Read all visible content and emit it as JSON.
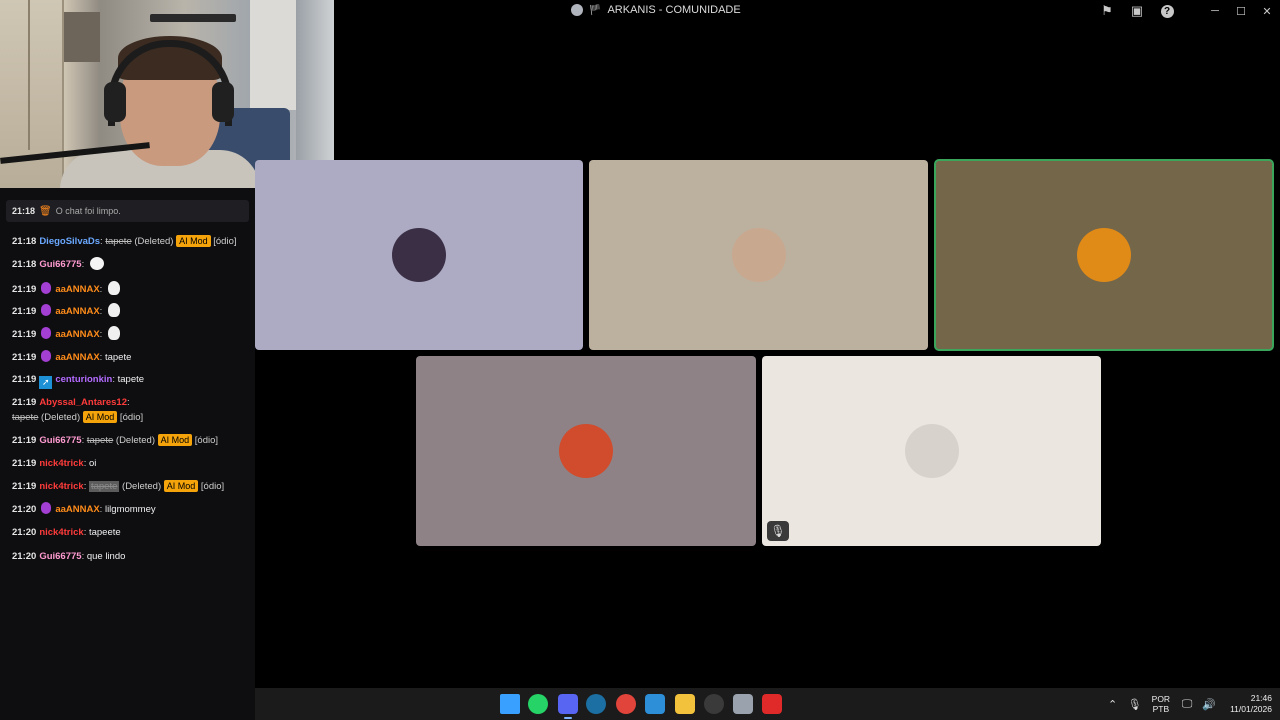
{
  "window": {
    "title": "ARKANIS - COMUNIDADE",
    "icons": [
      "inbox-icon",
      "window-icon",
      "help-icon"
    ],
    "help_glyph": "?",
    "controls": [
      "minimize",
      "maximize",
      "close"
    ]
  },
  "chat": {
    "system": {
      "time": "21:18",
      "text": "O chat foi limpo."
    },
    "messages": [
      {
        "time": "21:18",
        "user": "DiegoSilvaDs",
        "user_color": "#6aa8ff",
        "deleted_text": "tapete",
        "deleted_label": "(Deleted)",
        "badge": "AI Mod",
        "reason": "[ódio]"
      },
      {
        "time": "21:18",
        "user": "Gui66775",
        "user_color": "#ff9bd0",
        "emote": "blob"
      },
      {
        "time": "21:19",
        "user": "aaANNAX",
        "user_color": "#ff8c1a",
        "emote": "goose"
      },
      {
        "time": "21:19",
        "user": "aaANNAX",
        "user_color": "#ff8c1a",
        "emote": "goose"
      },
      {
        "time": "21:19",
        "user": "aaANNAX",
        "user_color": "#ff8c1a",
        "emote": "goose"
      },
      {
        "time": "21:19",
        "user": "aaANNAX",
        "user_color": "#ff8c1a",
        "text": "tapete"
      },
      {
        "time": "21:19",
        "user": "centurionkin",
        "user_color": "#b36bff",
        "text": "tapete"
      },
      {
        "time": "21:19",
        "user": "Abyssal_Antares12",
        "user_color": "#ff3b3b",
        "deleted_text": "tapete",
        "deleted_label": "(Deleted)",
        "badge": "AI Mod",
        "reason": "[ódio]"
      },
      {
        "time": "21:19",
        "user": "Gui66775",
        "user_color": "#ff9bd0",
        "deleted_text": "tapete",
        "deleted_label": "(Deleted)",
        "badge": "AI Mod",
        "reason": "[ódio]"
      },
      {
        "time": "21:19",
        "user": "nick4trick",
        "user_color": "#ff3b3b",
        "text": "oi"
      },
      {
        "time": "21:19",
        "user": "nick4trick",
        "user_color": "#ff3b3b",
        "deleted_text": "tapete",
        "deleted_label": "(Deleted)",
        "badge": "AI Mod",
        "reason": "[ódio]"
      },
      {
        "time": "21:20",
        "user": "aaANNAX",
        "user_color": "#ff8c1a",
        "text": "lilgmommey"
      },
      {
        "time": "21:20",
        "user": "nick4trick",
        "user_color": "#ff3b3b",
        "text": "tapeete"
      },
      {
        "time": "21:20",
        "user": "Gui66775",
        "user_color": "#ff9bd0",
        "text": "que lindo"
      }
    ]
  },
  "tiles": [
    {
      "bg": "#adabc4",
      "avatar": "skunk-avatar",
      "avatar_bg": "#3a2f45",
      "muted": false,
      "active": false
    },
    {
      "bg": "#bcb09e",
      "avatar": "crab-cowboy-avatar",
      "avatar_bg": "#c9a890",
      "muted": false,
      "active": false
    },
    {
      "bg": "#746649",
      "avatar": "duck-avatar",
      "avatar_bg": "#e08a18",
      "muted": false,
      "active": true
    },
    {
      "bg": "#8e8287",
      "avatar": "pixel-art-avatar",
      "avatar_bg": "#d04c2c",
      "muted": false,
      "active": false
    },
    {
      "bg": "#ebe6df",
      "avatar": "clock-cassette-avatar",
      "avatar_bg": "#d7d2cc",
      "muted": true,
      "active": false
    }
  ],
  "taskbar": {
    "apps": [
      {
        "name": "start-button",
        "color": "#3aa0ff"
      },
      {
        "name": "whatsapp-icon",
        "color": "#25d366"
      },
      {
        "name": "discord-icon",
        "color": "#5865f2",
        "active": true
      },
      {
        "name": "steam-icon",
        "color": "#1b6fa3"
      },
      {
        "name": "chrome-icon",
        "color": "#e0443a"
      },
      {
        "name": "photos-icon",
        "color": "#2d8fd8"
      },
      {
        "name": "explorer-icon",
        "color": "#f3c23c"
      },
      {
        "name": "obs-icon",
        "color": "#3a3a3a"
      },
      {
        "name": "settings-icon",
        "color": "#9aa3ad"
      },
      {
        "name": "youtube-icon",
        "color": "#e02929"
      }
    ],
    "lang": {
      "line1": "POR",
      "line2": "PTB"
    },
    "clock": {
      "time": "21:46",
      "date": "11/01/2026"
    }
  }
}
